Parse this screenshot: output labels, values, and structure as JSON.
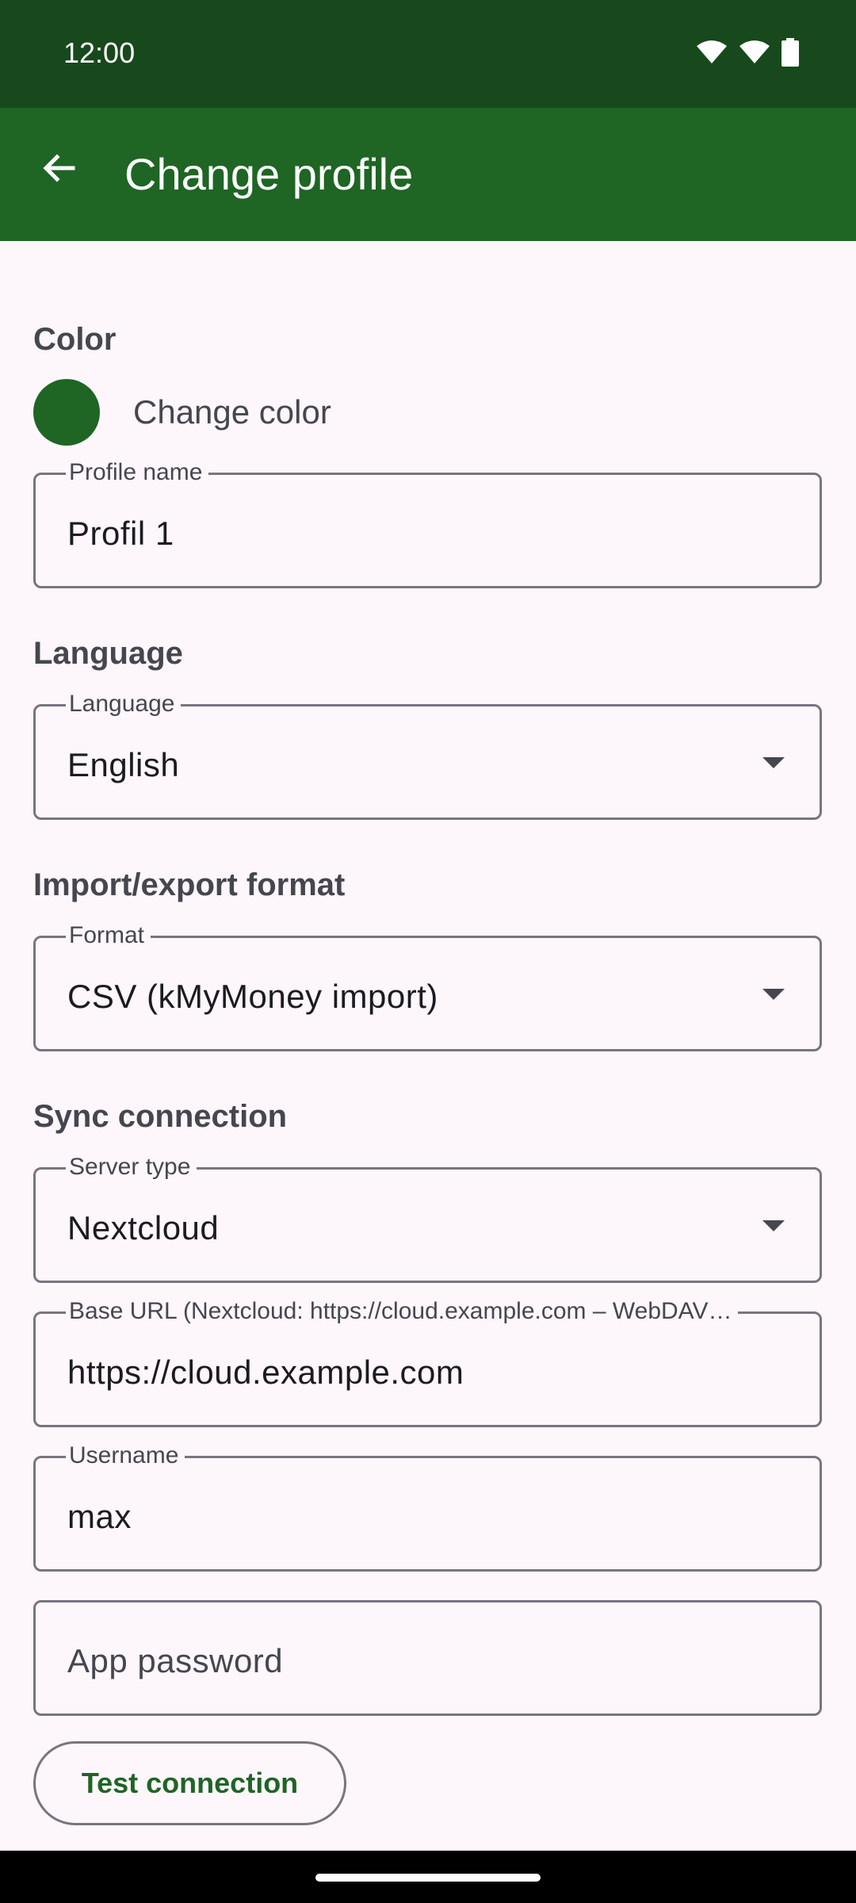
{
  "status_bar": {
    "time": "12:00"
  },
  "app_bar": {
    "title": "Change profile"
  },
  "color_section": {
    "title": "Color",
    "change_label": "Change color",
    "swatch_color": "#1f6524"
  },
  "profile_name": {
    "label": "Profile name",
    "value": "Profil 1"
  },
  "language_section": {
    "title": "Language",
    "field_label": "Language",
    "value": "English"
  },
  "format_section": {
    "title": "Import/export format",
    "field_label": "Format",
    "value": "CSV (kMyMoney import)"
  },
  "sync_section": {
    "title": "Sync connection",
    "server_type": {
      "label": "Server type",
      "value": "Nextcloud"
    },
    "base_url": {
      "label": "Base URL (Nextcloud: https://cloud.example.com – WebDAV…",
      "value": "https://cloud.example.com"
    },
    "username": {
      "label": "Username",
      "value": "max"
    },
    "app_password": {
      "placeholder": "App password"
    },
    "test_button": "Test connection"
  },
  "colors": {
    "status_bar": "#17491c",
    "app_bar": "#1f6524",
    "background": "#fdf7fc",
    "accent": "#1f6524"
  }
}
